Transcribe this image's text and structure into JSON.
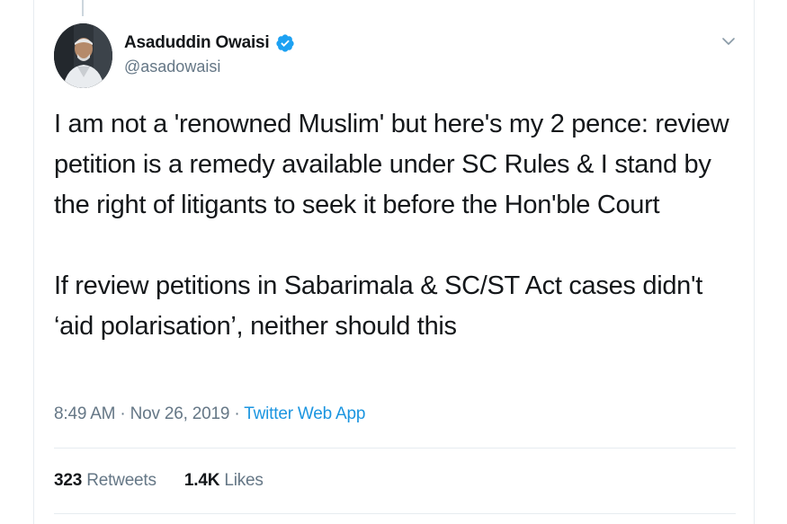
{
  "tweet": {
    "author": {
      "display_name": "Asaduddin Owaisi",
      "handle": "@asadowaisi",
      "verified": true
    },
    "text_paragraphs": [
      "I am not a 'renowned Muslim' but here's my 2 pence: review petition is a remedy available under SC Rules & I stand by the right of litigants to seek it before the Hon'ble Court",
      "If review petitions in Sabarimala & SC/ST Act cases didn't ‘aid polarisation’, neither should this"
    ],
    "time": "8:49 AM",
    "date": "Nov 26, 2019",
    "separator": "·",
    "source": "Twitter Web App",
    "stats": {
      "retweets_count": "323",
      "retweets_label": "Retweets",
      "likes_count": "1.4K",
      "likes_label": "Likes"
    }
  },
  "icons": {
    "verified": "verified-badge-icon",
    "menu": "chevron-down-icon",
    "avatar": "profile-avatar"
  },
  "colors": {
    "text": "#14171a",
    "secondary": "#657786",
    "link": "#1b95e0",
    "verified": "#1da1f2",
    "border": "#e6ecf0"
  }
}
